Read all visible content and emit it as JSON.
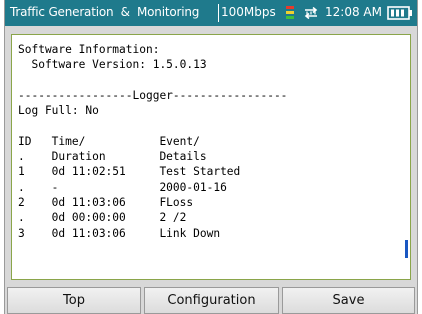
{
  "titlebar": {
    "app_title": "Traffic Generation  &  Monitoring",
    "rate": "100Mbps",
    "clock": "12:08 AM",
    "icons": [
      "signal-icon",
      "transfer-icon",
      "battery-icon"
    ]
  },
  "log": {
    "text": "Software Information:\n  Software Version: 1.5.0.13\n\n-----------------Logger-----------------\nLog Full: No\n\nID   Time/           Event/\n.    Duration        Details\n1    0d 11:02:51     Test Started\n.    -               2000-01-16\n2    0d 11:03:06     FLoss\n.    0d 00:00:00     2 /2\n3    0d 11:03:06     Link Down"
  },
  "softkeys": {
    "top": "Top",
    "configuration": "Configuration",
    "save": "Save"
  },
  "colors": {
    "titlebar": "#1f7a8c",
    "content_border": "#8aa54a",
    "scroll_thumb": "#1a57c2"
  }
}
